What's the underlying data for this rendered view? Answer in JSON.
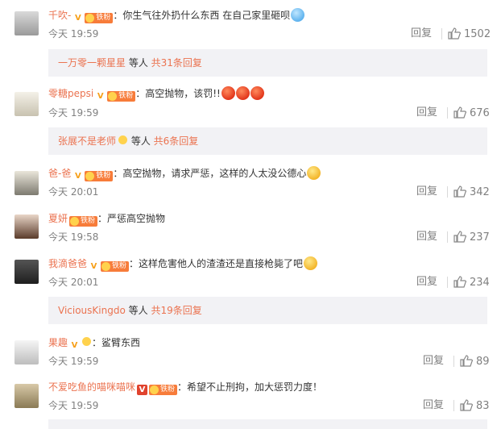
{
  "comments": [
    {
      "user": "千吹-",
      "fan": "铁粉",
      "text": "你生气往外扔什么东西 在自己家里砸呗",
      "time": "今天 19:59",
      "reply": "回复",
      "likes": "1502"
    },
    {
      "user": "零糖pepsi",
      "fan": "铁粉",
      "text": "高空抛物，该罚!!",
      "time": "今天 19:59",
      "reply": "回复",
      "likes": "676"
    },
    {
      "user": "爸-爸",
      "fan": "铁粉",
      "text": "高空抛物，请求严惩，这样的人太没公德心",
      "time": "今天 20:01",
      "reply": "回复",
      "likes": "342"
    },
    {
      "user": "夏妍",
      "fan": "铁粉",
      "text": "严惩高空抛物",
      "time": "今天 19:58",
      "reply": "回复",
      "likes": "237"
    },
    {
      "user": "我滴爸爸",
      "fan": "铁粉",
      "text": "这样危害他人的渣渣还是直接枪毙了吧",
      "time": "今天 20:01",
      "reply": "回复",
      "likes": "234"
    },
    {
      "user": "果趣",
      "text": "鲨臂东西",
      "time": "今天 19:59",
      "reply": "回复",
      "likes": "89"
    },
    {
      "user": "不爱吃鱼的喵咪喵咪",
      "fan": "铁粉",
      "text": "希望不止刑拘，加大惩罚力度！",
      "time": "今天 19:59",
      "reply": "回复",
      "likes": "83"
    }
  ],
  "sub_replies": [
    {
      "name": "一万零一颗星星",
      "mid": " 等人 ",
      "count": "共31条回复"
    },
    {
      "name": "张展不是老师",
      "mid": " 等人 ",
      "count": "共6条回复"
    },
    {
      "name": "ViciousKingdo",
      "mid": " 等人 ",
      "count": "共19条回复"
    }
  ],
  "colors": {
    "username": "#eb7350",
    "meta": "#808080",
    "sub_bg": "#f2f2f5",
    "v_gold": "#f6a01a",
    "v_red": "#e0432e",
    "fan_badge": "#f77c3a"
  }
}
